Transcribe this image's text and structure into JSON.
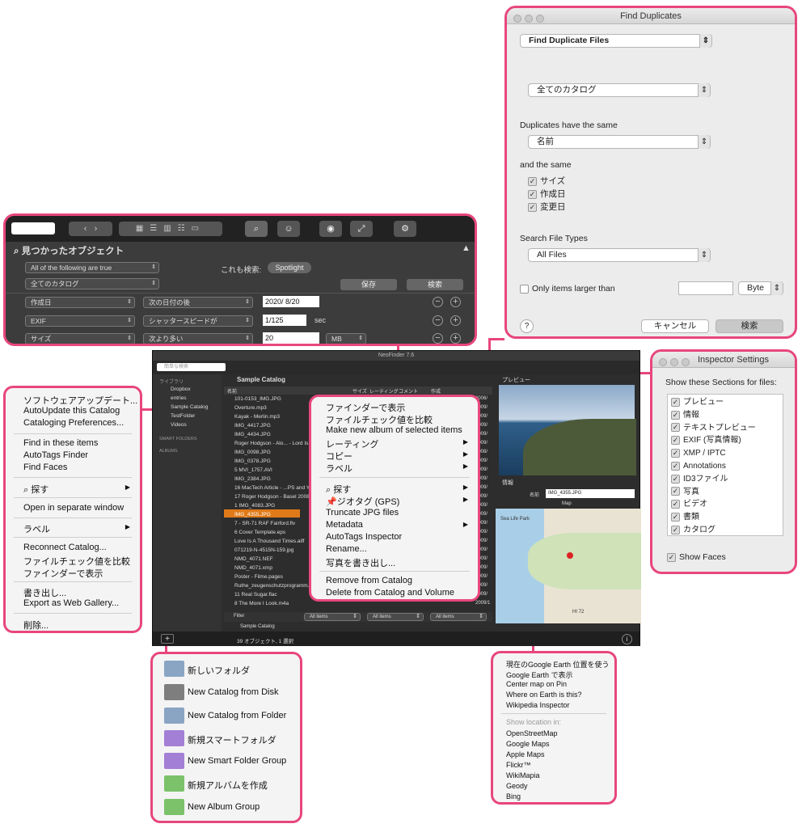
{
  "find_dup": {
    "title": "Find Duplicates",
    "mode": "Find Duplicate Files",
    "catalog": "全てのカタログ",
    "dup_label": "Duplicates have the same",
    "same_field": "名前",
    "and_label": "and the same",
    "checks": [
      "サイズ",
      "作成日",
      "変更日"
    ],
    "types_label": "Search File Types",
    "types": "All Files",
    "larger_label": "Only items larger than",
    "unit": "Byte",
    "help": "?",
    "cancel": "キャンセル",
    "search": "検索"
  },
  "search_panel": {
    "title": "見つかったオブジェクト",
    "match": "All of the following are true",
    "catalog": "全てのカタログ",
    "also": "これも検索:",
    "spotlight": "Spotlight",
    "save": "保存",
    "search": "検索",
    "rows": [
      {
        "field": "作成日",
        "op": "次の日付の後",
        "value": "2020/ 8/20"
      },
      {
        "field": "EXIF",
        "op": "シャッタースピードが",
        "value": "1/125",
        "unit": "sec"
      },
      {
        "field": "サイズ",
        "op": "次より多い",
        "value": "20",
        "unit": "MB"
      }
    ]
  },
  "main": {
    "title": "NeoFinder 7.6",
    "search_ph": "簡単な検索",
    "sidebar_head": "ライブラリ",
    "sidebar": [
      "Dropbox",
      "entries",
      "Sample Catalog",
      "TestFolder",
      "Videos"
    ],
    "smart": "SMART FOLDERS",
    "albums": "ALBUMS",
    "catalog_title": "Sample Catalog",
    "cols": [
      "名前",
      "サイズ",
      "レーティング",
      "コメント",
      "作成"
    ],
    "files": [
      "101-0153_IMG.JPG",
      "Overture.mp3",
      "Kayak - Merlin.mp3",
      "IMG_4417.JPG",
      "IMG_4434.JPG",
      "Roger Hodgson - Alo... - Lord Is Mine.m4a",
      "IMG_0098.JPG",
      "IMG_0378.JPG",
      "5 MVI_1757.AVI",
      "IMG_2384.JPG",
      "16 MacTech Article - ...PS and You.pdf",
      "17 Roger Hodgson - Basel 2008.m4a",
      "1 IMG_4083.JPG",
      "IMG_4355.JPG",
      "7 - SR-71 RAF Fairford.flv",
      "6 Cover Template.eps",
      "Love Is A Thousand Times.aiff",
      "071219-N-4515N-159.jpg",
      "NMD_4071.NEF",
      "NMD_4071.xmp",
      "Poster - Filme.pages",
      "Ruthe_zeugenschutzprogramm.gif",
      "11 Real Sugar.flac",
      "8 The More I Look.m4a"
    ],
    "dates": [
      "2006/",
      "2009/",
      "2009/",
      "2009/",
      "2009/",
      "2009/",
      "2008/",
      "2009/",
      "2009/",
      "2009/",
      "2009/",
      "2009/",
      "2009/",
      "2009/",
      "2009/",
      "2009/",
      "2009/",
      "2009/",
      "2009/",
      "2009/",
      "2009/",
      "2009/",
      "2009/",
      "2009/12/"
    ],
    "selected": "IMG_4355.JPG",
    "preview": "プレビュー",
    "info": "情報",
    "name_label": "名前",
    "name_val": "IMG_4355.JPG",
    "map": "Map",
    "filter": "Filter",
    "all_items": "All items",
    "path": "Sample Catalog",
    "status": "39 オブジェクト, 1 選択",
    "hi72": "HI 72",
    "sealife": "Sea Life Park"
  },
  "context_menu": {
    "group1": [
      "ファインダーで表示",
      "ファイルチェック値を比較",
      "Make new album of selected items",
      "レーティング",
      "コピー",
      "ラベル"
    ],
    "group2": [
      "探す",
      "ジオタグ (GPS)",
      "Truncate JPG files",
      "Metadata",
      "AutoTags Inspector",
      "Rename...",
      "写真を書き出し..."
    ],
    "group3": [
      "Remove from Catalog",
      "Delete from Catalog and Volume"
    ]
  },
  "left_menu": {
    "items": [
      "ソフトウェアアップデート...",
      "AutoUpdate this Catalog",
      "Cataloging Preferences...",
      "Find in these items",
      "AutoTags Finder",
      "Find Faces",
      "探す",
      "Open in separate window",
      "ラベル",
      "Reconnect Catalog...",
      "ファイルチェック値を比較",
      "ファインダーで表示",
      "書き出し...",
      "Export as Web Gallery...",
      "削除..."
    ]
  },
  "inspector": {
    "title": "Inspector Settings",
    "label": "Show these Sections for files:",
    "items": [
      "プレビュー",
      "情報",
      "テキストプレビュー",
      "EXIF (写真情報)",
      "XMP / IPTC",
      "Annotations",
      "ID3ファイル",
      "写真",
      "ビデオ",
      "書類",
      "カタログ"
    ],
    "faces": "Show Faces"
  },
  "add_menu": {
    "items": [
      "新しいフォルダ",
      "New Catalog from Disk",
      "New Catalog from Folder",
      "新規スマートフォルダ",
      "New Smart Folder Group",
      "新規アルバムを作成",
      "New Album Group"
    ]
  },
  "map_menu": {
    "items": [
      "現在のGoogle Earth 位置を使う",
      "Google Earth で表示",
      "Center map on Pin",
      "Where on Earth is this?",
      "Wikipedia Inspector"
    ],
    "show_in": "Show location in:",
    "services": [
      "OpenStreetMap",
      "Google Maps",
      "Apple Maps",
      "Flickr™",
      "WikiMapia",
      "Geody",
      "Bing"
    ]
  }
}
